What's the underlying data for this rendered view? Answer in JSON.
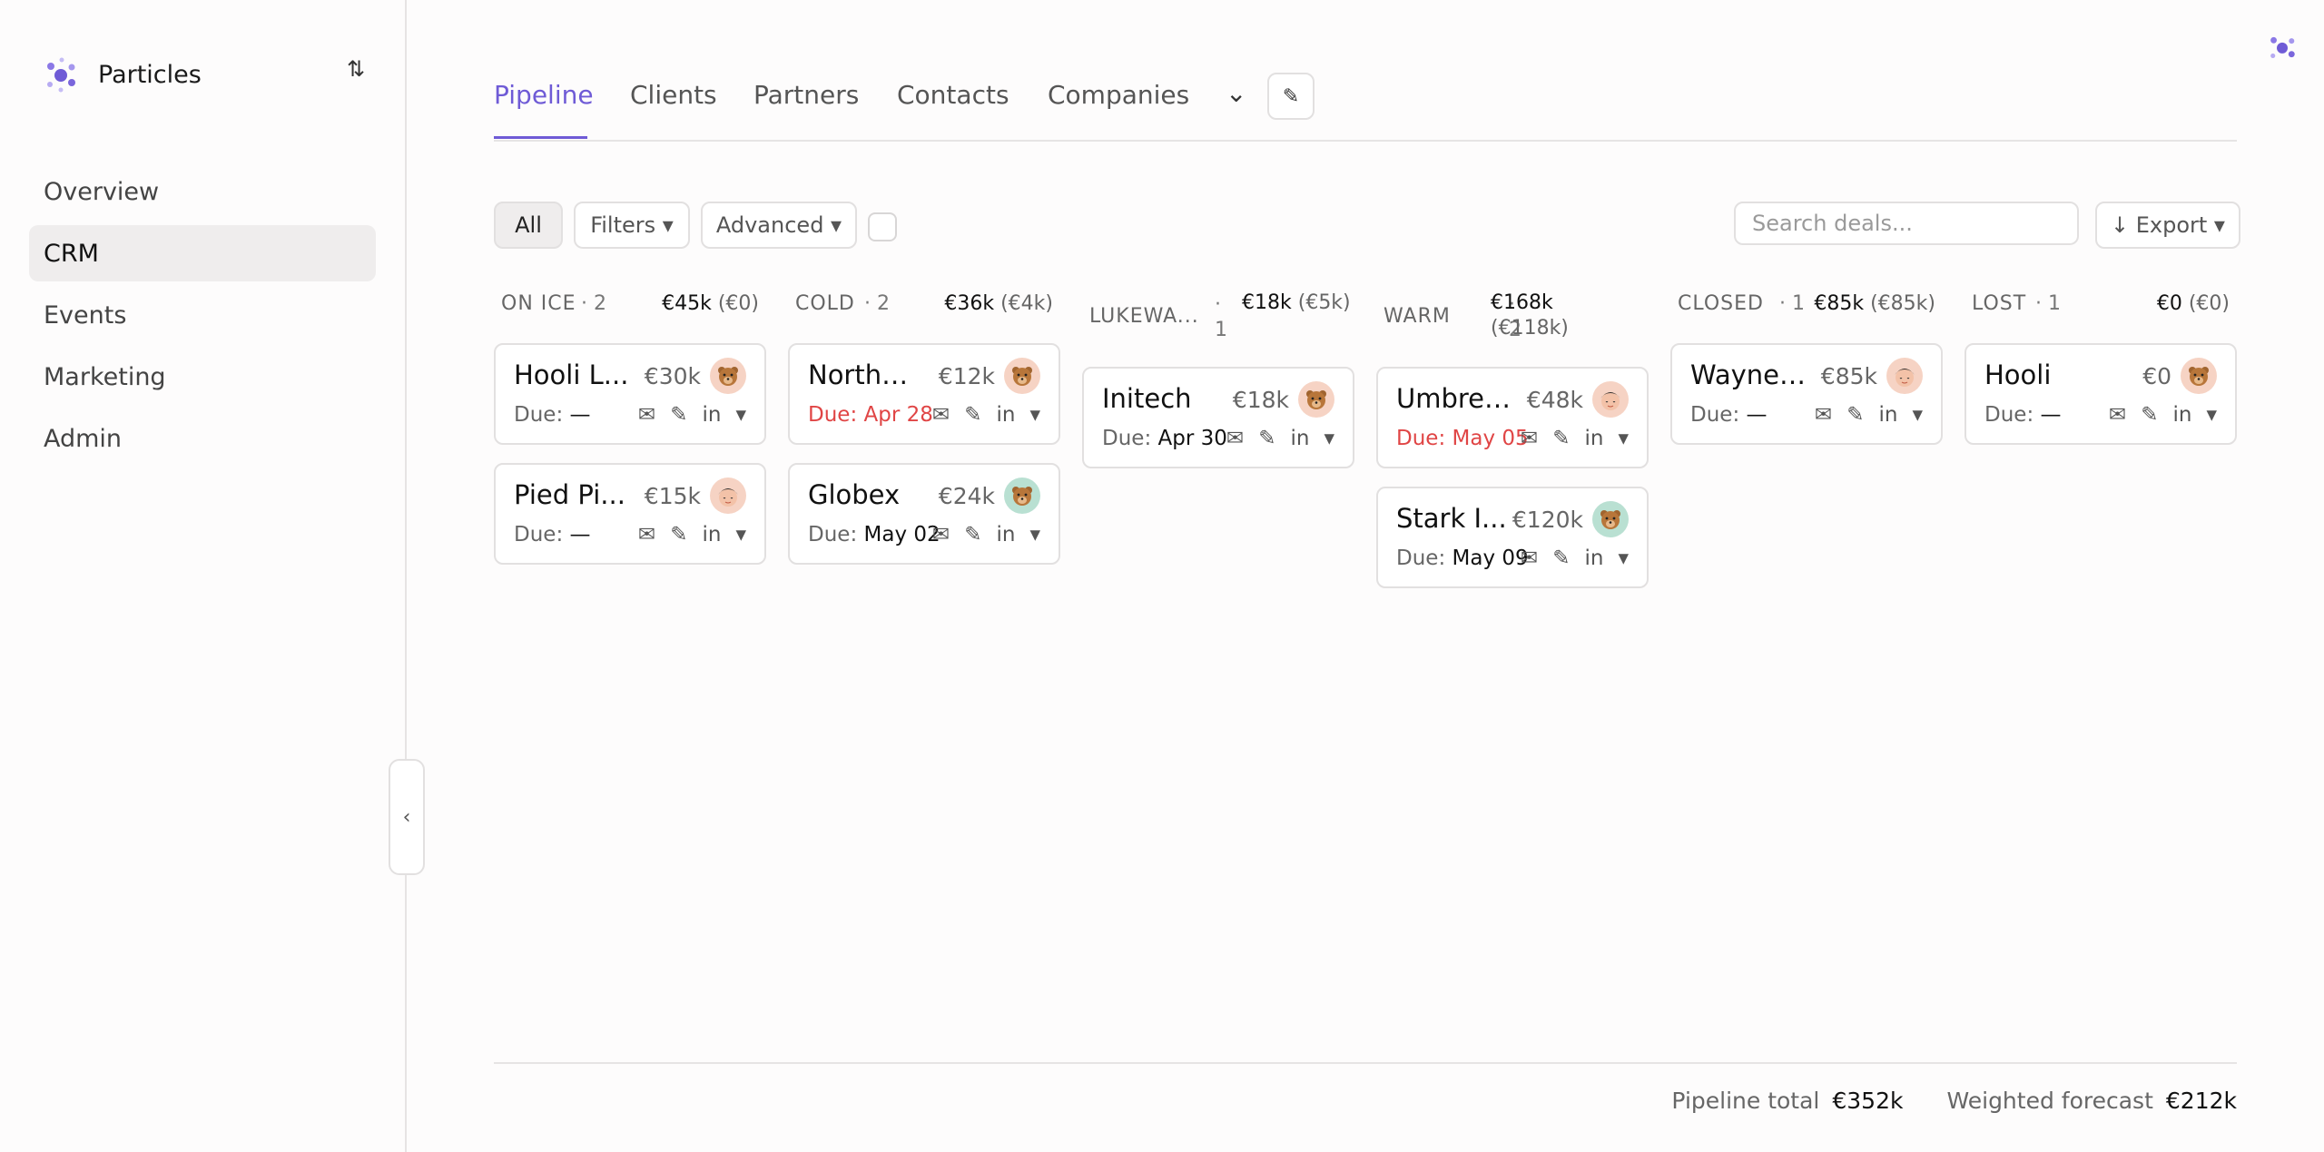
{
  "app": {
    "name": "Particles",
    "accent": "#6f5bd6",
    "switch_icon": "⇅"
  },
  "sidebar": {
    "items": [
      {
        "label": "Overview",
        "active": false
      },
      {
        "label": "CRM",
        "active": true
      },
      {
        "label": "Events",
        "active": false
      },
      {
        "label": "Marketing",
        "active": false
      },
      {
        "label": "Admin",
        "active": false
      }
    ],
    "collapse_icon": "‹"
  },
  "tabs": {
    "items": [
      "Pipeline",
      "Clients",
      "Partners",
      "Contacts",
      "Companies"
    ],
    "active": "Pipeline",
    "more_icon": "⌄",
    "edit_icon": "✎"
  },
  "toolbar": {
    "all": "All",
    "filters": "Filters ▾",
    "advanced": "Advanced ▾",
    "search_placeholder": "Search deals...",
    "export": "↓ Export ▾"
  },
  "columns": [
    {
      "name": "ON ICE",
      "count": "· 2",
      "amount": "€45k",
      "weighted": "(€0)",
      "cards": [
        {
          "name": "Hooli L...",
          "amount": "€30k",
          "due_label": "Due:",
          "due": "—",
          "overdue": false,
          "avatar": "bear-avatar"
        },
        {
          "name": "Pied Pi...",
          "amount": "€15k",
          "due_label": "Due:",
          "due": "—",
          "overdue": false,
          "avatar": "person-avatar"
        }
      ]
    },
    {
      "name": "COLD",
      "count": "· 2",
      "amount": "€36k",
      "weighted": "(€4k)",
      "cards": [
        {
          "name": "Northwi...",
          "amount": "€12k",
          "due_label": "Due:",
          "due": "Apr 28",
          "overdue": true,
          "avatar": "bear-avatar"
        },
        {
          "name": "Globex",
          "amount": "€24k",
          "due_label": "Due:",
          "due": "May 02",
          "overdue": false,
          "avatar": "bear-avatar-teal"
        }
      ]
    },
    {
      "name": "LUKEWA...",
      "count": "· 1",
      "amount": "€18k",
      "weighted": "(€5k)",
      "cards": [
        {
          "name": "Initech",
          "amount": "€18k",
          "due_label": "Due:",
          "due": "Apr 30",
          "overdue": false,
          "avatar": "bear-avatar"
        }
      ]
    },
    {
      "name": "WARM",
      "count": "· 2",
      "amount": "€168k",
      "weighted": "(€118k)",
      "cards": [
        {
          "name": "Umbrel...",
          "amount": "€48k",
          "due_label": "Due:",
          "due": "May 05",
          "overdue": true,
          "avatar": "person-avatar"
        },
        {
          "name": "Stark I...",
          "amount": "€120k",
          "due_label": "Due:",
          "due": "May 09",
          "overdue": false,
          "avatar": "bear-avatar-teal"
        }
      ]
    },
    {
      "name": "CLOSED",
      "count": "· 1",
      "amount": "€85k",
      "weighted": "(€85k)",
      "cards": [
        {
          "name": "Wayne ...",
          "amount": "€85k",
          "due_label": "Due:",
          "due": "—",
          "overdue": false,
          "avatar": "person-avatar"
        }
      ]
    },
    {
      "name": "LOST",
      "count": "· 1",
      "amount": "€0",
      "weighted": "(€0)",
      "cards": [
        {
          "name": "Hooli",
          "amount": "€0",
          "due_label": "Due:",
          "due": "—",
          "overdue": false,
          "avatar": "bear-avatar"
        }
      ]
    }
  ],
  "card_actions": {
    "email": "✉",
    "edit": "✎",
    "linkedin": "in",
    "more": "▾"
  },
  "footer": {
    "pipeline_label": "Pipeline total",
    "pipeline_value": "€352k",
    "forecast_label": "Weighted forecast",
    "forecast_value": "€212k"
  },
  "colors": {
    "overdue": "#e04545",
    "avatar_peach": "#f6d3c4",
    "avatar_teal": "#b9e0d2"
  }
}
